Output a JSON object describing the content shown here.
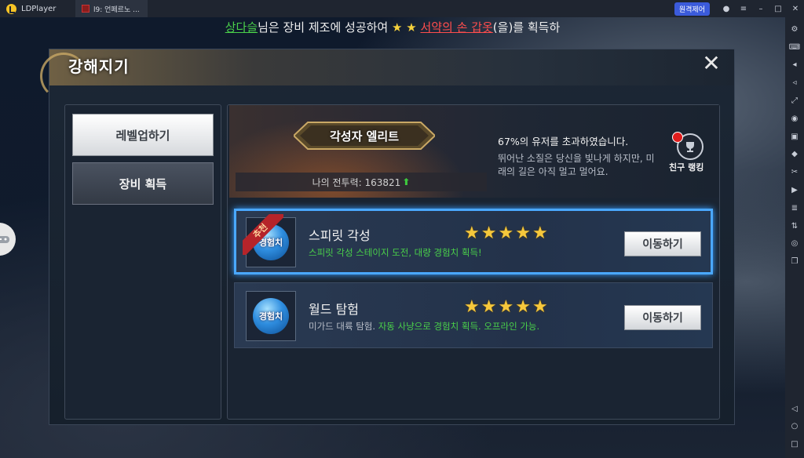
{
  "emulator": {
    "app_name": "LDPlayer",
    "tab_title": "l9: 언페르노 ...",
    "remote_label": "원격제어"
  },
  "ticker": {
    "name": "상다슬",
    "part1": "님은 장비 제조에 성공하여 ",
    "stars": "★ ★",
    "item": "서약의 손 갑옷",
    "part2": "(을)를 획득하"
  },
  "dialog": {
    "title": "강해지기",
    "close_glyph": "✕"
  },
  "sidebar_menu": [
    {
      "label": "레벨업하기",
      "active": true
    },
    {
      "label": "장비 획득",
      "active": false
    }
  ],
  "ranking": {
    "badge": "각성자 엘리트",
    "power_text": "나의 전투력: 163821",
    "percent_line": "67%의 유저를 초과하였습니다.",
    "description": "뛰어난 소질은 당신을 빛나게 하지만, 미래의 길은 아직 멀고 멀어요.",
    "friend_ranking_label": "친구 랭킹"
  },
  "quests": [
    {
      "badge": "추천",
      "icon_text": "경험치",
      "title": "스피릿 각성",
      "desc_plain": "",
      "desc_green": "스피릿 각성 스테이지 도전, 대량 경험치 획득!",
      "stars": 5,
      "button": "이동하기"
    },
    {
      "badge": "",
      "icon_text": "경험치",
      "title": "월드 탐험",
      "desc_plain": "미가드 대륙 탐험. ",
      "desc_green": "자동 사냥으로 경험치 획득. 오프라인 가능.",
      "stars": 5,
      "button": "이동하기"
    }
  ],
  "colors": {
    "highlight_green": "#4ad04a",
    "highlight_red": "#ff4d4d",
    "selected_border": "#4aa8ff",
    "star": "#f6c83c"
  }
}
